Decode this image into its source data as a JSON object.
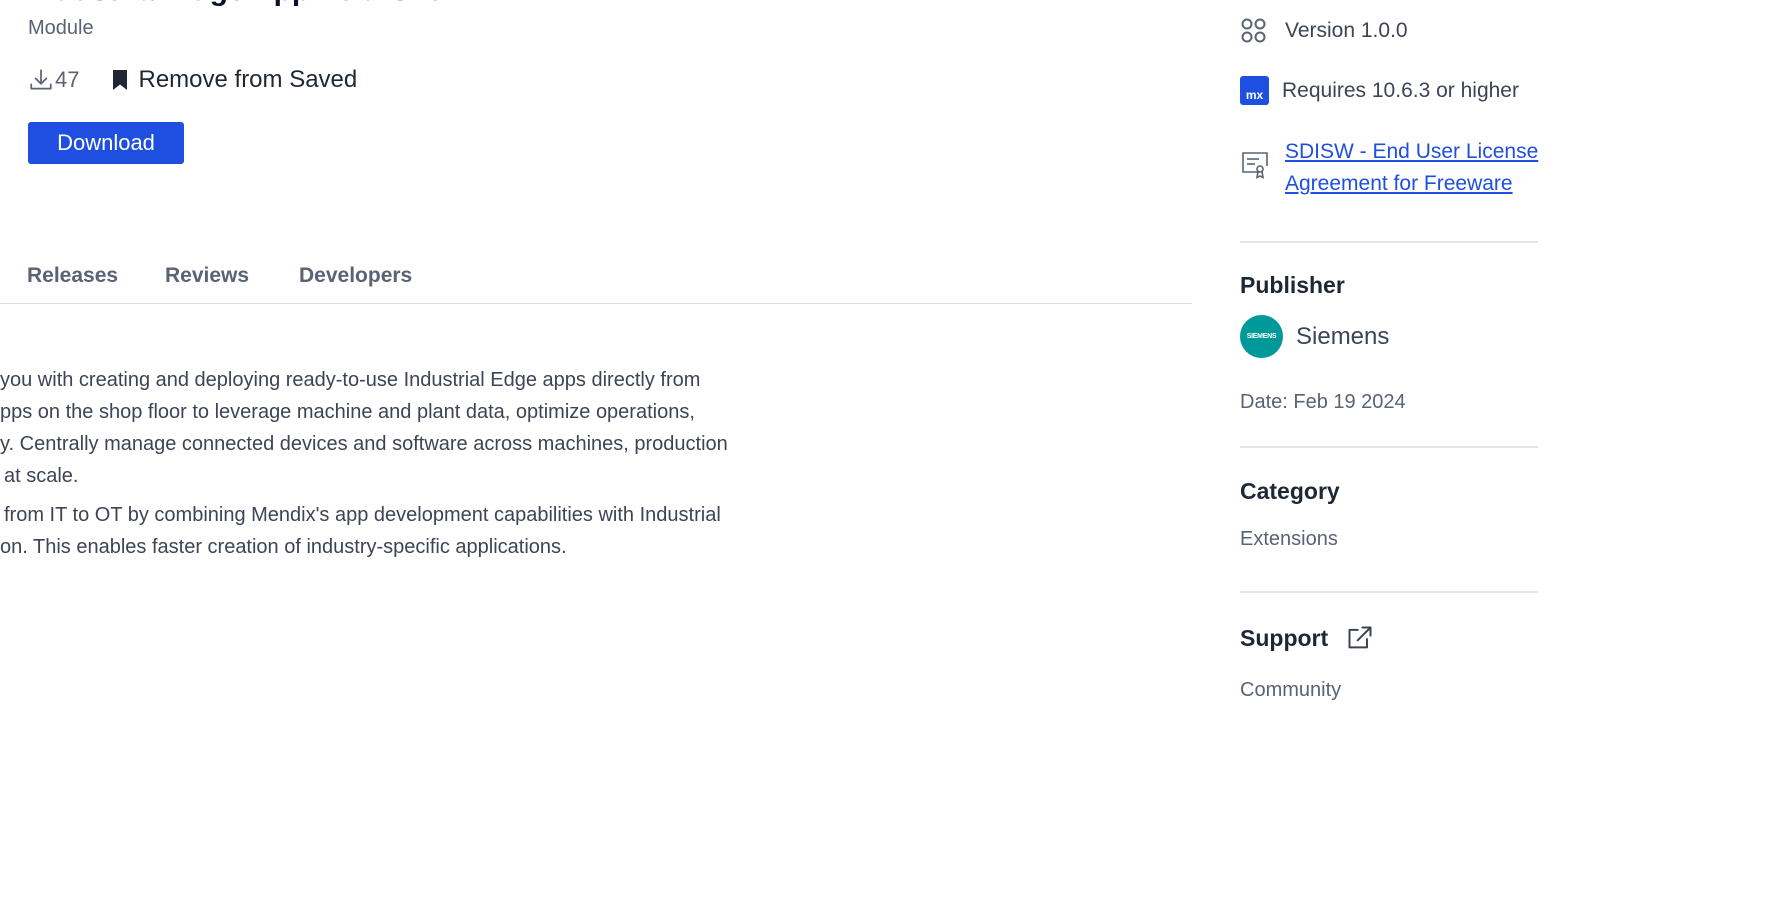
{
  "module": {
    "title": "Industrial Edge App Publisher",
    "type": "Module",
    "downloads": "47",
    "saved_label": "Remove from Saved",
    "download_button": "Download"
  },
  "tabs": [
    {
      "label": "Releases"
    },
    {
      "label": "Reviews"
    },
    {
      "label": "Developers"
    }
  ],
  "description": {
    "paragraph1": [
      "you with creating and deploying ready-to-use Industrial Edge apps directly from",
      "pps on the shop floor to leverage machine and plant data, optimize operations,",
      "y. Centrally manage connected devices and software across machines, production",
      "at scale."
    ],
    "paragraph2": [
      "from IT to OT by combining Mendix's app development capabilities with Industrial",
      "on. This enables faster creation of industry-specific applications."
    ]
  },
  "sidebar": {
    "version": "Version 1.0.0",
    "mx_badge": "mx",
    "requires": "Requires 10.6.3 or higher",
    "license_line1": "SDISW - End User License",
    "license_line2": "Agreement for Freeware",
    "publisher_heading": "Publisher",
    "publisher_logo_text": "SIEMENS",
    "publisher_name": "Siemens",
    "date": "Date: Feb 19 2024",
    "category_heading": "Category",
    "category_value": "Extensions",
    "support_heading": "Support",
    "support_value": "Community"
  },
  "colors": {
    "accent": "#1f4fe0",
    "publisher_logo": "#009999",
    "divider": "#e3e5e9"
  },
  "icons": {
    "downloads": "download-icon",
    "saved": "bookmark-icon",
    "version": "version-grid-icon",
    "requires": "mx-badge-icon",
    "license": "license-certificate-icon",
    "support": "external-link-icon"
  }
}
